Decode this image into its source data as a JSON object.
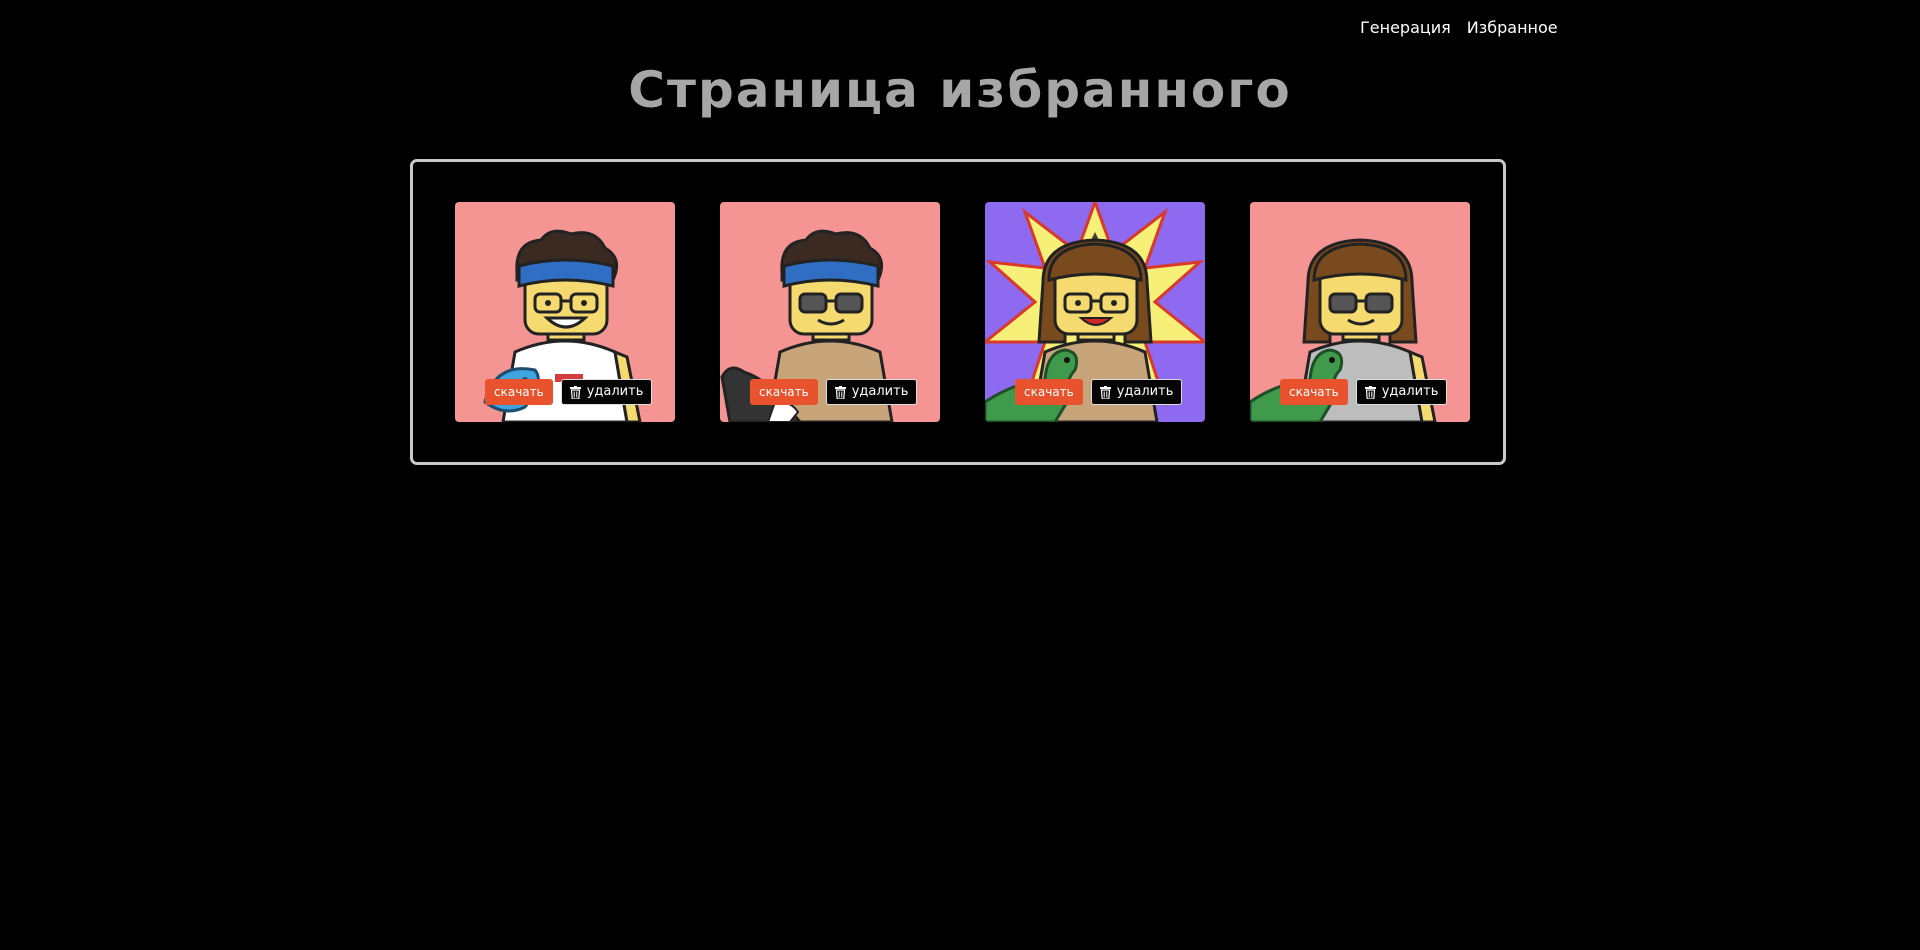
{
  "nav": {
    "generation": "Генерация",
    "favorites": "Избранное"
  },
  "page": {
    "title": "Страница избранного"
  },
  "cards": [
    {
      "background": "#f49593",
      "download_label": "скачать",
      "delete_label": "удалить",
      "delete_icon": "trash-icon"
    },
    {
      "background": "#f49593",
      "download_label": "скачать",
      "delete_label": "удалить",
      "delete_icon": "trash-icon"
    },
    {
      "background": "#8d6af0",
      "download_label": "скачать",
      "delete_label": "удалить",
      "delete_icon": "trash-icon"
    },
    {
      "background": "#f49593",
      "download_label": "скачать",
      "delete_label": "удалить",
      "delete_icon": "trash-icon"
    }
  ],
  "colors": {
    "background": "#000000",
    "title": "#a6a6a6",
    "panel_border": "#c9c9c9",
    "download_button": "#e8522c",
    "delete_button": "#050505"
  }
}
